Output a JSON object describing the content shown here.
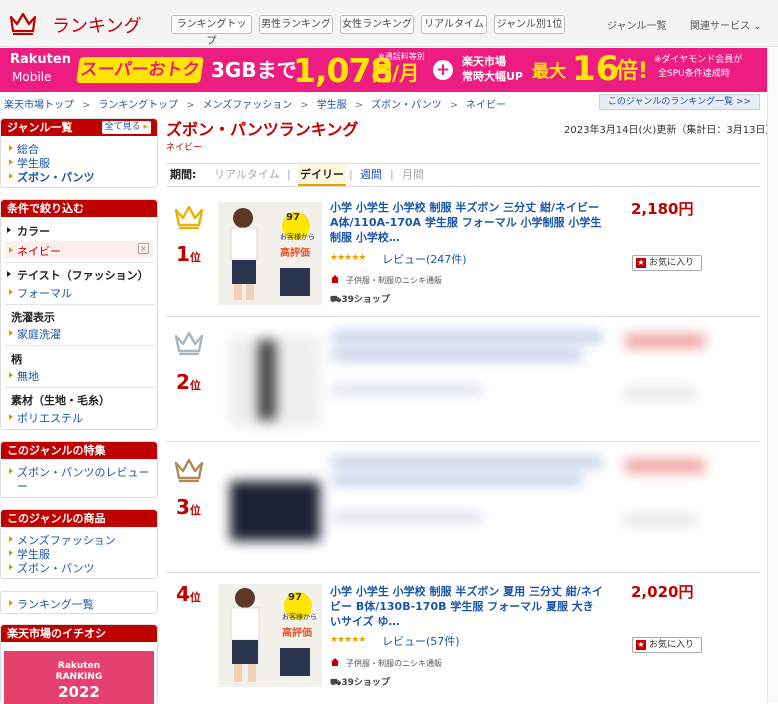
{
  "header": {
    "logo": "ランキング",
    "nav_buttons": [
      "ランキングトップ",
      "男性ランキング",
      "女性ランキング",
      "リアルタイム",
      "ジャンル別1位"
    ],
    "links": [
      "ジャンル一覧",
      "関連サービス"
    ]
  },
  "banner": {
    "brand_top": "Rakuten",
    "brand_bottom": "Mobile",
    "super": "スーパーおトク",
    "plan": "3GBまで",
    "price": "1,078",
    "unit": "円/月",
    "note": "※通話料等別",
    "plus": "+",
    "ichiba": "楽天市場",
    "ichiba2": "常時大幅UP",
    "max": "最大",
    "mult": "16",
    "bai": "倍!",
    "diamond": "※ダイヤモンド会員が",
    "spu": "全SPU条件達成時"
  },
  "breadcrumb": {
    "items": [
      "楽天市場トップ",
      "ランキングトップ",
      "メンズファッション",
      "学生服",
      "ズボン・パンツ",
      "ネイビー"
    ],
    "sep": ">",
    "right_link": "このジャンルのランキング一覧 >>"
  },
  "sidebar": {
    "genre_head": "ジャンル一覧",
    "see_all": "全て見る",
    "genres": [
      "総合",
      "学生服",
      "ズボン・パンツ"
    ],
    "filter_head": "条件で絞り込む",
    "filters": [
      {
        "title": "カラー",
        "value": "ネイビー"
      },
      {
        "title": "テイスト（ファッション）",
        "value": "フォーマル"
      },
      {
        "title": "洗濯表示",
        "value": "家庭洗濯"
      },
      {
        "title": "柄",
        "value": "無地"
      },
      {
        "title": "素材（生地・毛糸）",
        "value": "ポリエステル"
      }
    ],
    "feature_head": "このジャンルの特集",
    "feature_items": [
      "ズボン・パンツのレビュー",
      "ー"
    ],
    "products_head": "このジャンルの商品",
    "product_items": [
      "メンズファッション",
      "学生服",
      "ズボン・パンツ"
    ],
    "ranking_list": "ランキング一覧",
    "ichioshi_head": "楽天市場のイチオシ",
    "promo_top": "Rakuten",
    "promo_mid": "RANKING",
    "promo_year": "2022"
  },
  "main": {
    "title": "ズボン・パンツランキング",
    "subtitle": "ネイビー",
    "updated": "2023年3月14日(火)更新（集計日：3月13日）",
    "period_label": "期間:",
    "periods": [
      "リアルタイム",
      "デイリー",
      "週間",
      "月間"
    ],
    "period_sep": "|",
    "fav_label": "お気に入り",
    "fav_star": "★",
    "rank_suffix": "位",
    "items": [
      {
        "rank": "1",
        "title": "小学 小学生 小学校 制服 半ズボン 三分丈 紺/ネイビー A体/110A-170A 学生服 フォーマル 小学制服 小学生制服 小学校…",
        "stars": "★★★★★",
        "review": "レビュー(247件)",
        "shop": "子供服・制服のニシキ通販",
        "points": "39ショップ",
        "price": "2,180円",
        "img_badge_top": "97",
        "img_badge_mid": "お客様から",
        "img_badge_bottom": "高評価"
      },
      {
        "rank": "2"
      },
      {
        "rank": "3"
      },
      {
        "rank": "4",
        "title": "小学 小学生 小学校 制服 半ズボン 夏用 三分丈 紺/ネイビー B体/130B-170B 学生服 フォーマル 夏服 大きいサイズ ゆ…",
        "stars": "★★★★★",
        "review": "レビュー(57件)",
        "shop": "子供服・制服のニシキ通販",
        "points": "39ショップ",
        "price": "2,020円",
        "img_badge_top": "97",
        "img_badge_mid": "お客様から",
        "img_badge_bottom": "高評価"
      }
    ]
  },
  "colors": {
    "brand_red": "#bf0000",
    "banner_pink": "#ec1c80",
    "banner_yellow": "#ffe600",
    "link_blue": "#1a55a8"
  }
}
